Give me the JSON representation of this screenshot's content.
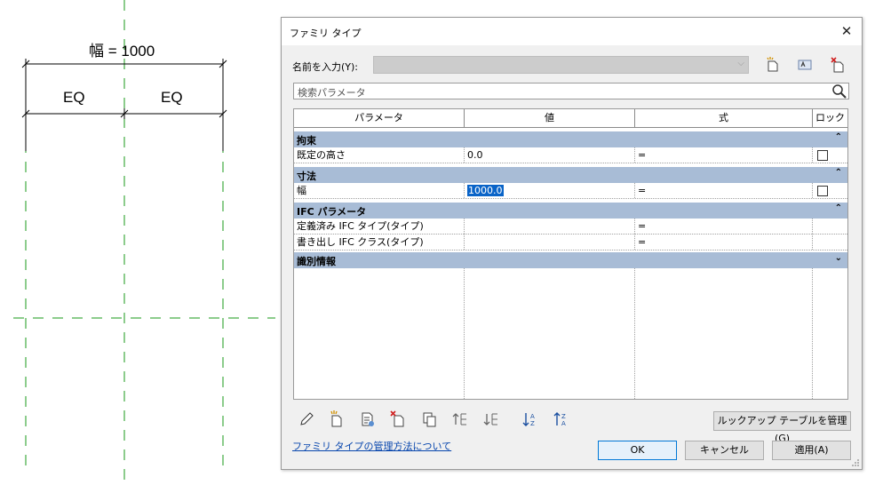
{
  "drawing": {
    "width_label": "幅 = 1000",
    "eq_left": "EQ",
    "eq_right": "EQ"
  },
  "dialog": {
    "title": "ファミリ タイプ",
    "close_glyph": "✕",
    "name_label": "名前を入力(Y):",
    "name_value": "",
    "search_placeholder": "検索パラメータ",
    "columns": [
      "パラメータ",
      "値",
      "式",
      "ロック"
    ],
    "groups": [
      {
        "label": "拘束",
        "chevron": "⌃",
        "rows": [
          {
            "param": "既定の高さ",
            "value": "0.0",
            "formula": "=",
            "lock": "unchecked"
          }
        ]
      },
      {
        "label": "寸法",
        "chevron": "⌃",
        "rows": [
          {
            "param": "幅",
            "value": "1000.0",
            "formula": "=",
            "lock": "unchecked"
          }
        ]
      },
      {
        "label": "IFC パラメータ",
        "chevron": "⌃",
        "rows": [
          {
            "param": "定義済み IFC タイプ(タイプ)",
            "value": "",
            "formula": "=",
            "lock": ""
          },
          {
            "param": "書き出し IFC クラス(タイプ)",
            "value": "",
            "formula": "=",
            "lock": ""
          }
        ]
      },
      {
        "label": "識別情報",
        "chevron": "⌄",
        "rows": []
      }
    ],
    "lookup_button": "ルックアップ テーブルを管理(G)",
    "help_link": "ファミリ タイプの管理方法について",
    "ok": "OK",
    "cancel": "キャンセル",
    "apply": "適用(A)"
  },
  "colors": {
    "group_header": "#a8bcd6",
    "selection": "#0a64c8",
    "guide_line": "#1a9a1a"
  }
}
